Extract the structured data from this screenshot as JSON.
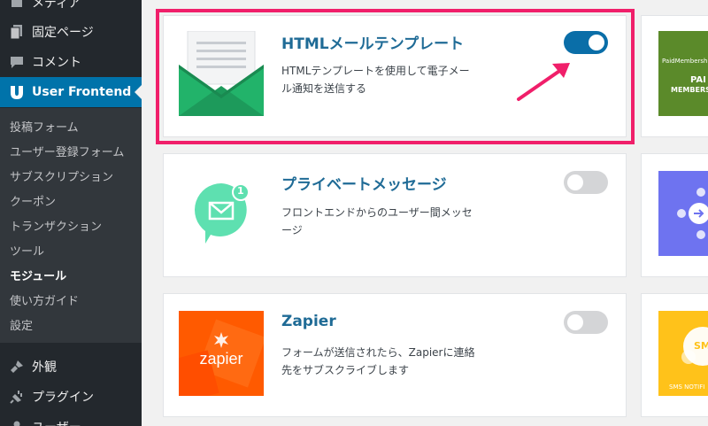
{
  "sidebar": {
    "menu": [
      {
        "label": "メディア",
        "icon": "media-icon"
      },
      {
        "label": "固定ページ",
        "icon": "page-icon"
      },
      {
        "label": "コメント",
        "icon": "comment-icon"
      },
      {
        "label": "User Frontend",
        "icon": "user-frontend-icon"
      },
      {
        "label": "外観",
        "icon": "appearance-icon"
      },
      {
        "label": "プラグイン",
        "icon": "plugin-icon"
      },
      {
        "label": "ユーザー",
        "icon": "users-icon"
      }
    ],
    "submenu": [
      {
        "label": "投稿フォーム"
      },
      {
        "label": "ユーザー登録フォーム"
      },
      {
        "label": "サブスクリプション"
      },
      {
        "label": "クーポン"
      },
      {
        "label": "トランザクション"
      },
      {
        "label": "ツール"
      },
      {
        "label": "モジュール"
      },
      {
        "label": "使い方ガイド"
      },
      {
        "label": "設定"
      }
    ]
  },
  "modules": [
    {
      "title": "HTMLメールテンプレート",
      "desc_line1": "HTMLテンプレートを使用して電子メー",
      "desc_line2": "ル通知を送信する",
      "enabled": true
    },
    {
      "title": "プライベートメッセージ",
      "desc_line1": "フロントエンドからのユーザー間メッセ",
      "desc_line2": "ージ",
      "enabled": false,
      "badge": "1"
    },
    {
      "title": "Zapier",
      "desc_line1": "フォームが送信されたら、Zapierに連絡",
      "desc_line2": "先をサブスクライブします",
      "enabled": false,
      "logo": "zapier"
    }
  ],
  "right_column": [
    {
      "brand": "PaidMembership",
      "title": "PAI",
      "subtitle": "MEMBERSHI"
    },
    {
      "icon": "social-login-icon"
    },
    {
      "icon": "sms-icon",
      "bubble": "SMS",
      "caption": "SMS NOTIFI"
    }
  ],
  "colors": {
    "sidebar_bg": "#23282d",
    "submenu_bg": "#32373c",
    "active_bg": "#0073aa",
    "highlight": "#f01f6a",
    "title_blue": "#1f6b96",
    "toggle_on": "#0a6ea8",
    "toggle_off": "#d4d5d7"
  }
}
